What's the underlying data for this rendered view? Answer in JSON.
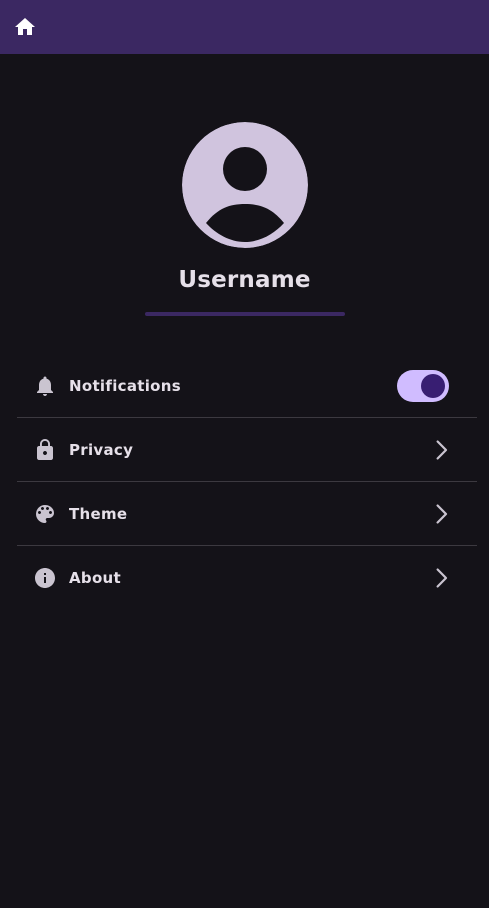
{
  "colors": {
    "background": "#141218",
    "app_bar": "#3b2862",
    "on_surface": "#e6e0e9",
    "avatar": "#d0c4de",
    "toggle_track": "#d0bcff",
    "toggle_thumb": "#381e72",
    "divider": "#3c3940"
  },
  "app_bar": {
    "icon": "home-icon"
  },
  "profile": {
    "avatar_icon": "account-circle-icon",
    "username": "Username"
  },
  "settings": {
    "items": [
      {
        "id": "notifications",
        "label": "Notifications",
        "icon": "bell-icon",
        "control": "toggle",
        "enabled": true
      },
      {
        "id": "privacy",
        "label": "Privacy",
        "icon": "lock-icon",
        "control": "chevron"
      },
      {
        "id": "theme",
        "label": "Theme",
        "icon": "palette-icon",
        "control": "chevron"
      },
      {
        "id": "about",
        "label": "About",
        "icon": "info-icon",
        "control": "chevron"
      }
    ]
  }
}
